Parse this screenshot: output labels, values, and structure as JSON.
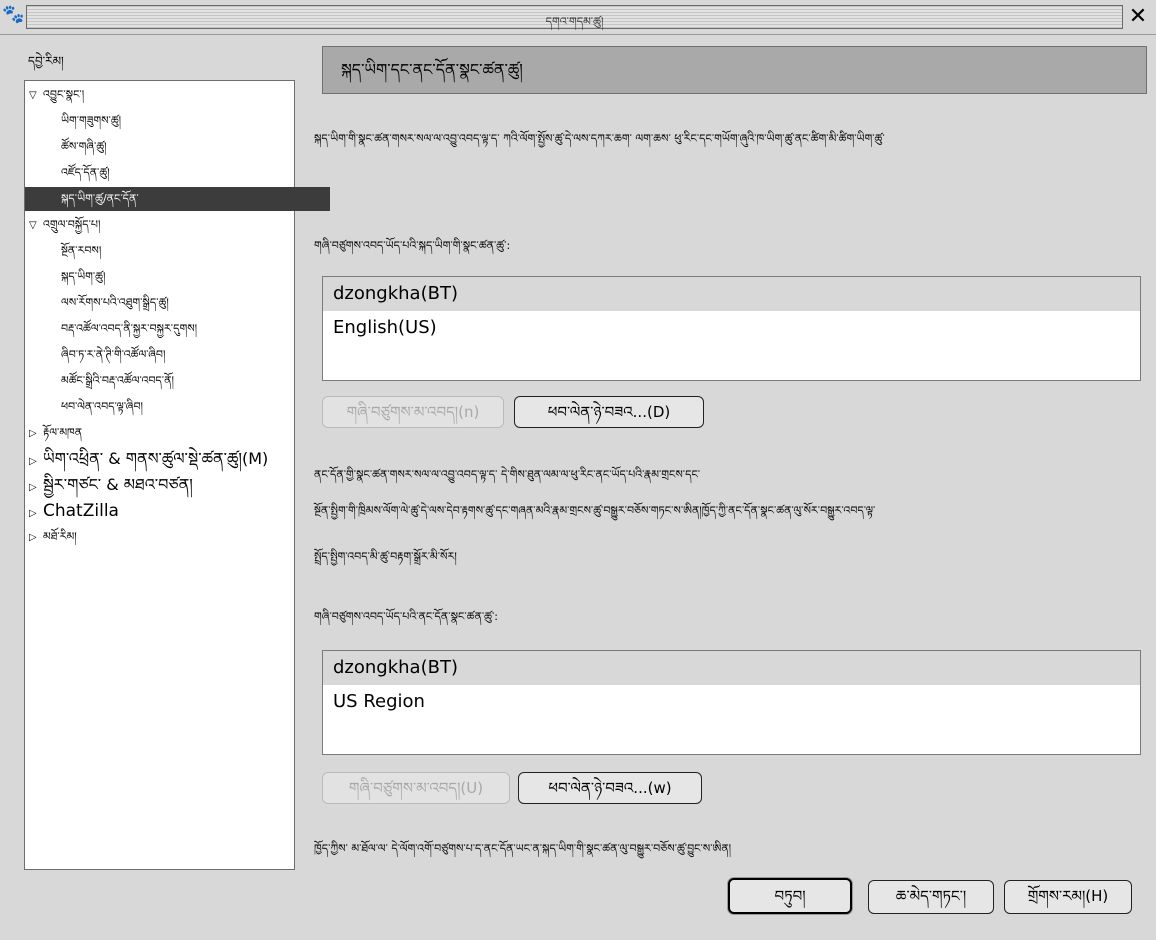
{
  "window": {
    "title": "དགའ་གདམ་ཚུ།",
    "app_icon": "paw-icon",
    "close_glyph": "✕"
  },
  "sidebar": {
    "label": "དབྱེ་རིམ།",
    "items": [
      {
        "label": "འབྱུང་སྣང་།",
        "expander": "▽"
      },
      {
        "label": "ཡིག་གཟུགས་ཚུ།"
      },
      {
        "label": "ཚོས་གཞི་ཚུ།"
      },
      {
        "label": "འཛོད་དོན་ཚུ།"
      },
      {
        "label": "སྐད་ཡིག་ཚུ/ནང་དོན་"
      },
      {
        "label": "འགྲུལ་བསྐྱོད་པ།",
        "expander": "▽"
      },
      {
        "label": "སྔོན་རབས།"
      },
      {
        "label": "སྐད་ཡིག་ཚུ།"
      },
      {
        "label": "ལས་རོགས་པའི་འཐུག་སྒྲིད་ཚུ།"
      },
      {
        "label": "བརྡ་འཚོལ་འབད་ནི་སྐྱར་བསྐྱར་དུགས།"
      },
      {
        "label": "ཞིབ་ཏ་ར་ནེ་ཊི་གི་འཚོལ་ཞིབ།"
      },
      {
        "label": "མཚོང་སྒྲིའི་བརྡ་འཚོལ་འབད་ནོ།"
      },
      {
        "label": "ཕབ་ལེན་འབད་ལྟ་ཞིབ།"
      },
      {
        "label": "རྟོལ་མཁན",
        "expander": "▷"
      },
      {
        "label": "ཡིག་འཕྲིན་ & གནས་ཚུལ་སྡེ་ཚན་ཚུ།(M)",
        "expander": "▷"
      },
      {
        "label": "སྦྱིར་གཙང་ & མཐའ་བཙན།",
        "expander": "▷"
      },
      {
        "label": "ChatZilla",
        "expander": "▷"
      },
      {
        "label": "མཐོ་རིམ།",
        "expander": "▷"
      }
    ]
  },
  "main": {
    "header": "སྐད་ཡིག་དང་ནང་དོན་སྣང་ཚན་ཚུ།",
    "intro": "སྐད་ཡིག་གི་སྣང་ཚན་གསར་སལ་ལ་འབྱུ་འབད་ལྟ་ད་ ཀའི་ལོག་སྤྱོས་ཚུ་དེ་ལས་དཀར་ཆག་ ལག་ཆས་ ཕུ་རིང་དང་གཡོག་ཞུའི་ཁ་ཡིག་ཚུ་ནང་ཚིག་མི་ཚིག་ཡིག་ཚུ་",
    "installed_lang_label": "གཞི་བཙུགས་འབད་ཡོད་པའི་སྐད་ཡིག་གི་སྣང་ཚན་ཚུ་:",
    "languages": [
      "dzongkha(BT)",
      "English(US)"
    ],
    "uninstall_lang_button": "གཞི་བཙུགས་མ་འབད།(n)",
    "download_lang_button": "ཕབ་ལེན་ཉེ་བཟའ...(D)",
    "content_para_1": "ནང་དོན་གྱི་སྣང་ཚན་གསར་སལ་ལ་འབྱུ་འབད་ལྟ་ད་ དེ་གིས་ཐུན་ལམ་ལ་ཕུ་རིང་ནང་ཡོད་པའི་རྣམ་གྲངས་དང་",
    "content_para_2": "སྔོན་སྤྱིག་གི་ཁྲིམས་ལོག་ལེ་ཚུ་དེ་ལས་དེབ་རྟགས་ཚུ་དང་གཞན་མའི་རྣམ་གྲངས་ཚུ་བསྒྱུར་བཅོས་གཏང་ས་ཨིན།ཁྱོད་ཀྱི་ནང་དོན་སྣང་ཚན་ལུ་སོར་བསྒྱུར་འབད་ལྟ་",
    "content_para_3": "སྤྲོད་སྤྱིག་འབད་མི་ཚུ་བརྟག་སྒྲོར་མི་སོར།",
    "installed_content_label": "གཞི་བཙུགས་འབད་ཡོད་པའི་ནང་དོན་སྣང་ཚན་ཚུ་:",
    "regions": [
      "dzongkha(BT)",
      "US Region"
    ],
    "uninstall_content_button": "གཞི་བཙུགས་མ་འབད།(U)",
    "download_content_button": "ཕབ་ལེན་ཉེ་བཟའ...(w)",
    "footer_note": "ཁྱོད་ཀྱིས་ མ་ཐོལ་ལ་ དེ་ལོག་འགོ་བཙུགས་པ་ད་ནང་དོན་ཡང་ན་སྐད་ཡིག་གི་སྣང་ཚན་ལུ་བསྒྱུར་བཅོས་ཚུ་བྱུང་ས་ཨིན།"
  },
  "footer": {
    "ok_button": "བཏུབ།",
    "cancel_button": "ཆ་མེད་གཏང་།",
    "help_button": "གྲོགས་རམ།(H)"
  }
}
